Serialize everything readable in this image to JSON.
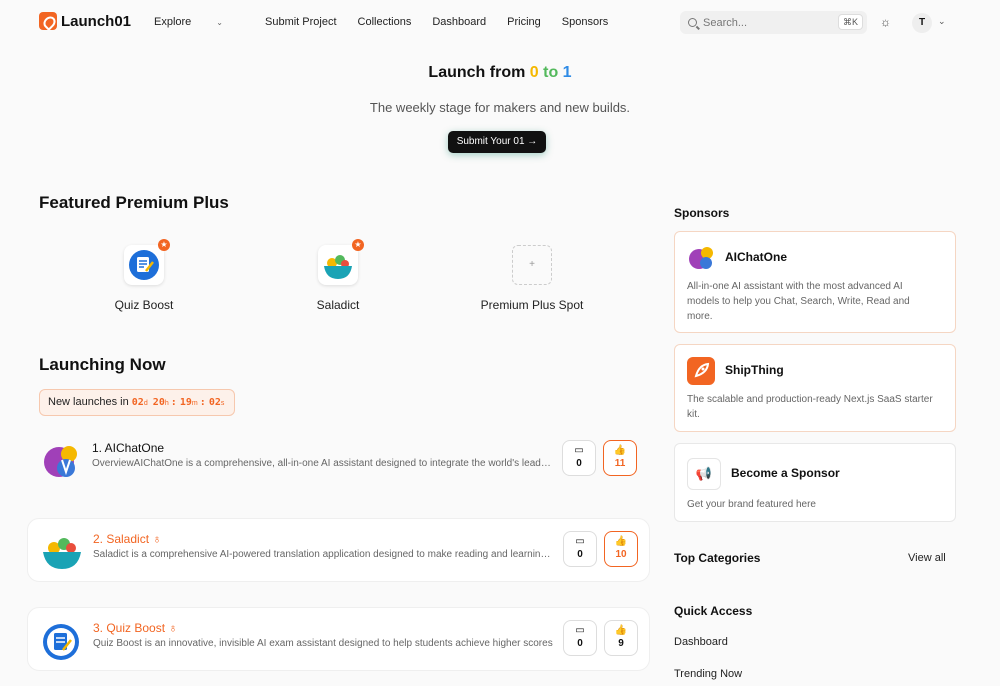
{
  "header": {
    "logo": "Launch01",
    "nav": [
      {
        "label": "Explore",
        "has_dropdown": true
      },
      {
        "label": "Submit Project"
      },
      {
        "label": "Collections"
      },
      {
        "label": "Dashboard"
      },
      {
        "label": "Pricing"
      },
      {
        "label": "Sponsors"
      }
    ],
    "search_placeholder": "Search...",
    "search_shortcut": "⌘K",
    "avatar_initial": "T"
  },
  "hero": {
    "title_prefix": "Launch from ",
    "title_0": "0",
    "title_to": " to ",
    "title_1": "1",
    "subtitle": "The weekly stage for makers and new builds.",
    "cta": "Submit Your 01 →"
  },
  "featured": {
    "title": "Featured Premium Plus",
    "items": [
      {
        "name": "Quiz Boost"
      },
      {
        "name": "Saladict"
      },
      {
        "name": "Premium Plus Spot",
        "placeholder_symbol": "+"
      }
    ]
  },
  "launching": {
    "title": "Launching Now",
    "countdown_label": "New launches in",
    "countdown": {
      "d": "02",
      "h": "20",
      "m": "19",
      "s": "02",
      "d_unit": "d",
      "h_unit": "h",
      "m_unit": "m",
      "s_unit": "s"
    },
    "items": [
      {
        "rank_title": "1. AIChatOne",
        "desc": "OverviewAIChatOne is a comprehensive, all-in-one AI assistant designed to integrate the world's leading AI models",
        "comments": "0",
        "votes": "11"
      },
      {
        "rank_title": "2. Saladict",
        "desc": "Saladict is a comprehensive AI-powered translation application designed to make reading and learning languages easier",
        "comments": "0",
        "votes": "10"
      },
      {
        "rank_title": "3. Quiz Boost",
        "desc": "Quiz Boost is an innovative, invisible AI exam assistant designed to help students achieve higher scores",
        "comments": "0",
        "votes": "9"
      }
    ]
  },
  "sidebar": {
    "sponsors_title": "Sponsors",
    "sponsors": [
      {
        "name": "AIChatOne",
        "desc": "All-in-one AI assistant with the most advanced AI models to help you Chat, Search, Write, Read and more."
      },
      {
        "name": "ShipThing",
        "desc": "The scalable and production-ready Next.js SaaS starter kit."
      },
      {
        "name": "Become a Sponsor",
        "desc": "Get your brand featured here"
      }
    ],
    "top_categories": "Top Categories",
    "view_all": "View all",
    "quick_access": "Quick Access",
    "quick_links": [
      "Dashboard",
      "Trending Now"
    ]
  },
  "colors": {
    "accent": "#f26522",
    "dark": "#111111"
  }
}
